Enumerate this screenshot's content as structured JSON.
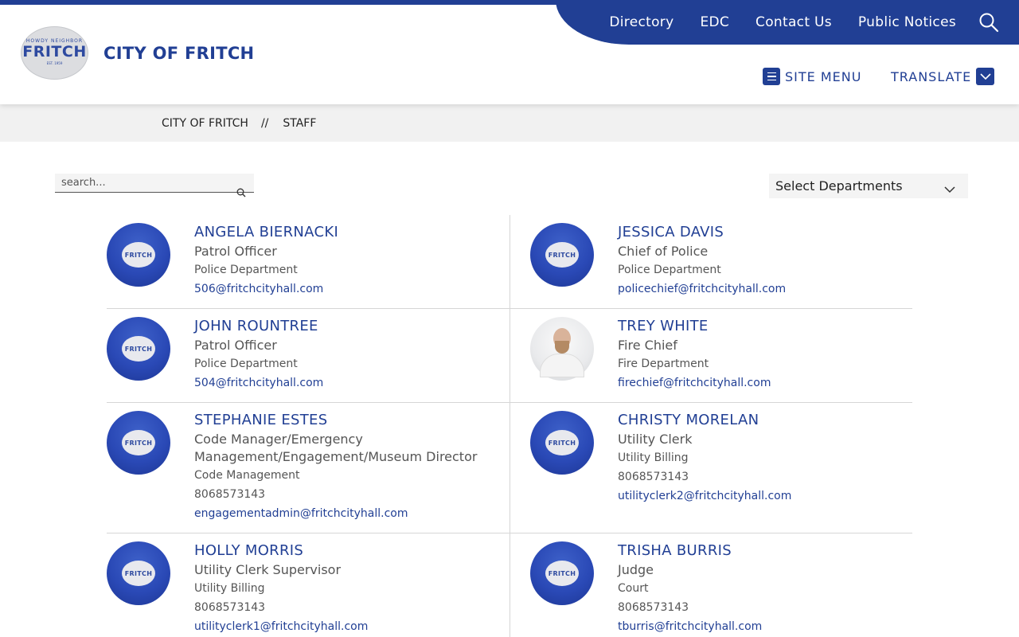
{
  "header": {
    "site_name": "CITY OF FRITCH",
    "logo": {
      "top_text": "HOWDY NEIGHBOR",
      "main_text": "FRITCH",
      "est_text": "EST. 1959"
    },
    "top_nav": [
      "Directory",
      "EDC",
      "Contact Us",
      "Public Notices"
    ],
    "site_menu_label": "SITE MENU",
    "translate_label": "TRANSLATE"
  },
  "breadcrumb": {
    "home": "CITY OF FRITCH",
    "separator": "//",
    "current": "STAFF"
  },
  "search": {
    "placeholder": "search..."
  },
  "department_filter": {
    "selected": "Select Departments"
  },
  "avatar_logo_text": "FRITCH",
  "staff": [
    {
      "name": "ANGELA BIERNACKI",
      "title": "Patrol Officer",
      "department": "Police Department",
      "phone": "",
      "email": "506@fritchcityhall.com",
      "photo": false
    },
    {
      "name": "JESSICA DAVIS",
      "title": "Chief of Police",
      "department": "Police Department",
      "phone": "",
      "email": "policechief@fritchcityhall.com",
      "photo": false
    },
    {
      "name": "JOHN ROUNTREE",
      "title": "Patrol Officer",
      "department": "Police Department",
      "phone": "",
      "email": "504@fritchcityhall.com",
      "photo": false
    },
    {
      "name": "TREY WHITE",
      "title": "Fire Chief",
      "department": "Fire Department",
      "phone": "",
      "email": "firechief@fritchcityhall.com",
      "photo": true
    },
    {
      "name": "STEPHANIE ESTES",
      "title": "Code Manager/Emergency Management/Engagement/Museum Director",
      "department": "Code Management",
      "phone": "8068573143",
      "email": "engagementadmin@fritchcityhall.com",
      "photo": false
    },
    {
      "name": "CHRISTY MORELAN",
      "title": "Utility Clerk",
      "department": "Utility Billing",
      "phone": "8068573143",
      "email": "utilityclerk2@fritchcityhall.com",
      "photo": false
    },
    {
      "name": "HOLLY MORRIS",
      "title": "Utility Clerk Supervisor",
      "department": "Utility Billing",
      "phone": "8068573143",
      "email": "utilityclerk1@fritchcityhall.com",
      "photo": false
    },
    {
      "name": "TRISHA BURRIS",
      "title": "Judge",
      "department": "Court",
      "phone": "8068573143",
      "email": "tburris@fritchcityhall.com",
      "photo": false
    }
  ],
  "colors": {
    "brand_blue": "#213f94",
    "breadcrumb_bg": "#f1f1f1",
    "divider": "#d6d6d6"
  }
}
